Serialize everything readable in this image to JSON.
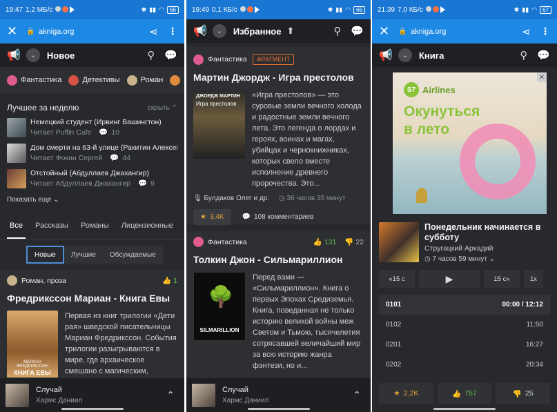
{
  "phone1": {
    "status": {
      "time": "19:47",
      "speed": "1,2 МБ/с",
      "battery": "66"
    },
    "url": {
      "host": "akniga.org"
    },
    "appbar": {
      "title": "Новое"
    },
    "categories": [
      "Фантастика",
      "Детективы",
      "Роман"
    ],
    "best": {
      "title": "Лучшее за неделю",
      "hide": "скрыть",
      "items": [
        {
          "title": "Немецкий студент (Ирвинг Вашингтон)",
          "reader": "Читает Puffin Cafe",
          "comments": "10"
        },
        {
          "title": "Дом смерти на 63-й улице (Ракитин Алексей)",
          "reader": "Читает Фокин Сергей",
          "comments": "44"
        },
        {
          "title": "Отстойный (Абдуллаев Джахангир)",
          "reader": "Читает Абдуллаев Джахангир",
          "comments": "9"
        }
      ],
      "more": "Показать еще"
    },
    "tabs": [
      "Все",
      "Рассказы",
      "Романы",
      "Лицензионные"
    ],
    "subtabs": [
      "Новые",
      "Лучшие",
      "Обсуждаемые"
    ],
    "card": {
      "genre": "Роман, проза",
      "likes": "1",
      "title": "Фредрикссон Мариан - Книга Евы",
      "desc": "Первая из книг трилогии «Дети рая» шведской писательницы Мариан Фредрикссон. События трилогии разыгрываются в мире, где архаическое смешано с магическим, мифологическим",
      "cover_top": "МАРИАН ФРЕДРИКССОН",
      "cover_title": "КНИГА ЕВЫ"
    },
    "mini": {
      "title": "Случай",
      "author": "Хармс Даниил"
    }
  },
  "phone2": {
    "status": {
      "time": "19:49",
      "speed": "0,1 КБ/с",
      "battery": "66"
    },
    "appbar": {
      "title": "Избранное"
    },
    "card1": {
      "genre": "Фантастика",
      "badge": "ФРАГМЕНТ",
      "title": "Мартин Джордж - Игра престолов",
      "desc": "«Игра престолов» — это суровые земли вечного холода и радостные земли вечного лета. Это легенда о лордах и героях, воинах и магах, убийцах и чернокнижниках, которых свело вместе исполнение древнего пророчества. Это...",
      "readers": "Булдаков Олег и др.",
      "duration": "36 часов 35 минут",
      "rating": "3,4K",
      "comments": "108 комментариев",
      "cover_author": "ДЖОРДЖ МАРТИН",
      "cover_title": "Игра престолов"
    },
    "card2": {
      "genre": "Фантастика",
      "up": "131",
      "down": "22",
      "title": "Толкин Джон - Сильмариллион",
      "desc": "Перед вами — «Сильмариллион». Книга о первых Эпохах Средиземья. Книга, поведанная не только историю великой войны меж Светом и Тьмою, тысячелетия сотрясавшей величайший мир за всю историю жанра фэнтези, но и...",
      "cover_title": "SILMARILLION"
    },
    "mini": {
      "title": "Случай",
      "author": "Хармс Даниил"
    }
  },
  "phone3": {
    "status": {
      "time": "21:39",
      "speed": "7,0 КБ/с",
      "battery": "67"
    },
    "url": {
      "host": "akniga.org"
    },
    "appbar": {
      "title": "Книга"
    },
    "ad": {
      "brand": "Airlines",
      "slogan_1": "Окунуться",
      "slogan_2": "в лето",
      "logo": "S7"
    },
    "book": {
      "title": "Понедельник начинается в субботу",
      "author": "Стругацкий Аркадий",
      "duration": "7 часов 59 минут"
    },
    "controls": {
      "back": "15 с",
      "fwd": "15 с",
      "speed": "1x"
    },
    "chapters": [
      {
        "name": "0101",
        "time": "00:00 / 12:12"
      },
      {
        "name": "0102",
        "time": "11:50"
      },
      {
        "name": "0201",
        "time": "16:27"
      },
      {
        "name": "0202",
        "time": "20:34"
      }
    ],
    "bottom": {
      "rating": "2,2K",
      "up": "757",
      "down": "25"
    }
  }
}
